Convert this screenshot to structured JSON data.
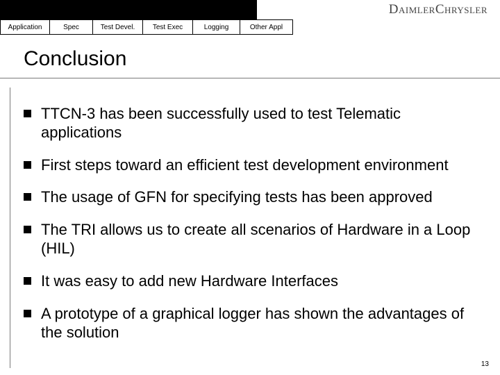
{
  "brand": {
    "part1": "Daimler",
    "part2": "Chrysler"
  },
  "tabs": [
    {
      "label": "Application"
    },
    {
      "label": "Spec"
    },
    {
      "label": "Test Devel."
    },
    {
      "label": "Test Exec"
    },
    {
      "label": "Logging"
    },
    {
      "label": "Other Appl"
    }
  ],
  "title": "Conclusion",
  "bullets": [
    "TTCN-3 has been successfully used to test Telematic applications",
    "First steps toward an efficient test development environment",
    "The usage of GFN for specifying tests has been approved",
    "The TRI allows us to create all scenarios of Hardware in a Loop (HIL)",
    "It was easy to add new Hardware Interfaces",
    "A prototype of a graphical logger has shown the advantages of the solution"
  ],
  "page_number": "13"
}
